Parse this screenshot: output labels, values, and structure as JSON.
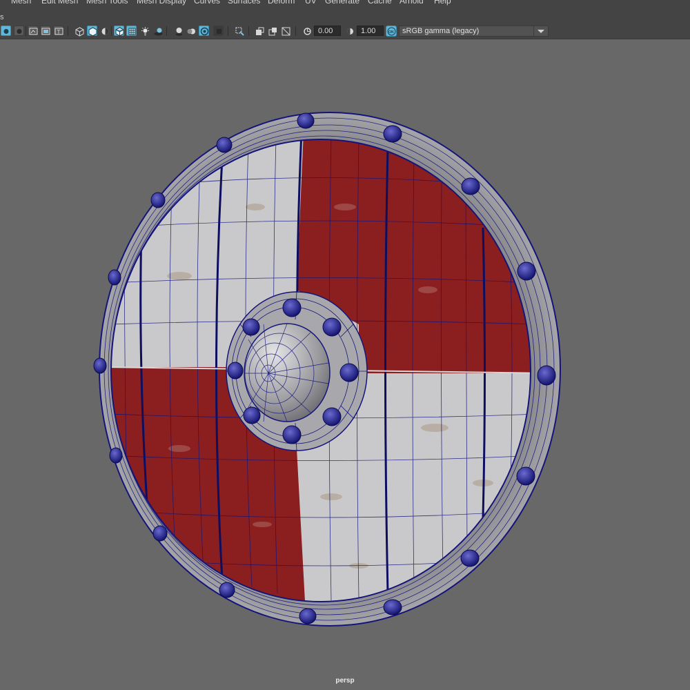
{
  "menubar": {
    "items": [
      "Mesh",
      "Edit Mesh",
      "Mesh Tools",
      "Mesh Display",
      "Curves",
      "Surfaces",
      "Deform",
      "UV",
      "Generate",
      "Cache",
      "Arnold",
      "Help"
    ]
  },
  "panel": {
    "label": "s"
  },
  "toolbar": {
    "exposure_value": "0.00",
    "gamma_value": "1.00",
    "colorspace_selected": "sRGB gamma (legacy)",
    "cm_badge": "ON",
    "icons": [
      "camera-attributes-icon",
      "film-gate-icon",
      "resolution-gate-icon",
      "safe-action-icon",
      "safe-title-icon",
      "wireframe-icon",
      "smooth-shade-icon",
      "flat-shade-icon",
      "wireframe-on-shaded-icon",
      "textured-icon",
      "use-lights-icon",
      "shadows-icon",
      "ambient-occlusion-icon",
      "motion-blur-icon",
      "anti-aliasing-icon",
      "depth-of-field-icon",
      "isolate-select-icon",
      "xray-icon",
      "xray-joints-icon",
      "xray-active-icon",
      "exposure-icon",
      "gamma-icon",
      "color-management-icon"
    ]
  },
  "viewport": {
    "camera_label": "persp"
  },
  "colors": {
    "viewport_bg": "#686868",
    "shield_red": "#8b1f1f",
    "shield_white": "#c8c8c8",
    "wireframe": "#14147a",
    "toolbar_active": "#5fb8d8"
  }
}
